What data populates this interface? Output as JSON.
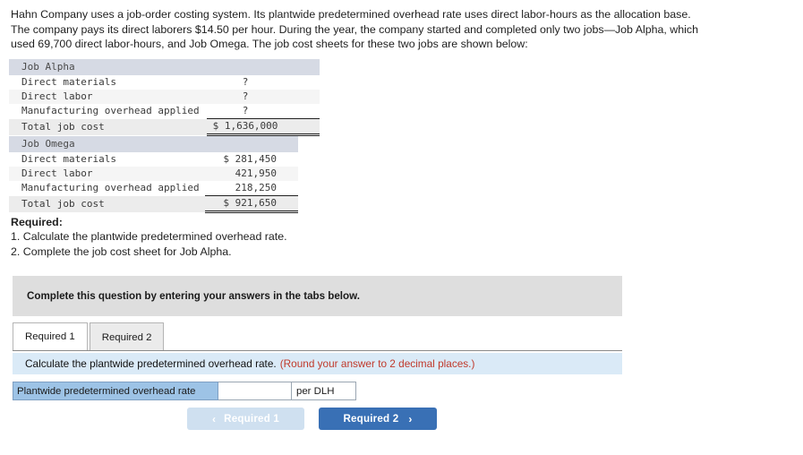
{
  "intro": {
    "text": "Hahn Company uses a job-order costing system. Its plantwide predetermined overhead rate uses direct labor-hours as the allocation base. The company pays its direct laborers $14.50 per hour. During the year, the company started and completed only two jobs—Job Alpha, which used 69,700 direct labor-hours, and Job Omega. The job cost sheets for these two jobs are shown below:"
  },
  "job_alpha": {
    "title": "Job Alpha",
    "rows": [
      {
        "label": "Direct materials",
        "value": "?"
      },
      {
        "label": "Direct labor",
        "value": "?"
      },
      {
        "label": "Manufacturing overhead applied",
        "value": "?"
      }
    ],
    "total_label": "Total job cost",
    "total_value": "$ 1,636,000"
  },
  "job_omega": {
    "title": "Job Omega",
    "rows": [
      {
        "label": "Direct materials",
        "value": "$ 281,450"
      },
      {
        "label": "Direct labor",
        "value": "421,950"
      },
      {
        "label": "Manufacturing overhead applied",
        "value": "218,250"
      }
    ],
    "total_label": "Total job cost",
    "total_value": "$ 921,650"
  },
  "required": {
    "heading": "Required:",
    "item1": "1. Calculate the plantwide predetermined overhead rate.",
    "item2": "2. Complete the job cost sheet for Job Alpha."
  },
  "banner": {
    "text": "Complete this question by entering your answers in the tabs below."
  },
  "tabs": [
    {
      "label": "Required 1",
      "state": "active"
    },
    {
      "label": "Required 2",
      "state": "inactive"
    }
  ],
  "instruction": {
    "main": "Calculate the plantwide predetermined overhead rate.",
    "note": "(Round your answer to 2 decimal places.)"
  },
  "answer": {
    "label": "Plantwide predetermined overhead rate",
    "value": "",
    "placeholder": "",
    "unit": "per DLH"
  },
  "nav": {
    "prev_label": "Required 1",
    "prev_chevron": "‹",
    "next_label": "Required 2",
    "next_chevron": "›"
  },
  "colors": {
    "accent_blue": "#3970b5",
    "disabled_blue": "#cfe0f0",
    "answer_label_blue": "#9dc3e6",
    "instruction_blue": "#daeaf7",
    "banner_gray": "#dedede",
    "table_header_gray": "#d6dae4",
    "note_red": "#c0392b"
  }
}
